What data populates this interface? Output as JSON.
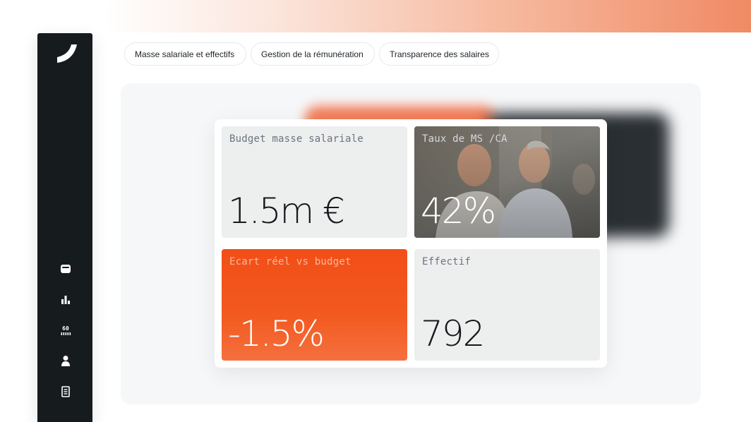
{
  "brand": {
    "accent": "#f24e17",
    "sidebar_bg": "#161b1e",
    "logo_icon": "brand-swoosh-icon"
  },
  "sidebar": {
    "items": [
      {
        "icon": "wallet-icon"
      },
      {
        "icon": "bar-chart-icon"
      },
      {
        "icon": "counter-icon",
        "glyph": "60"
      },
      {
        "icon": "user-icon"
      },
      {
        "icon": "document-icon"
      }
    ]
  },
  "tabs": [
    {
      "label": "Masse salariale et effectifs"
    },
    {
      "label": "Gestion de la rémunération"
    },
    {
      "label": "Transparence des salaires"
    }
  ],
  "kpis": [
    {
      "label": "Budget masse salariale",
      "value": "1.5m €"
    },
    {
      "label": "Taux de MS /CA",
      "value": "42%"
    },
    {
      "label": "Ecart réel vs budget",
      "value": "-1.5%"
    },
    {
      "label": "Effectif",
      "value": "792"
    }
  ]
}
